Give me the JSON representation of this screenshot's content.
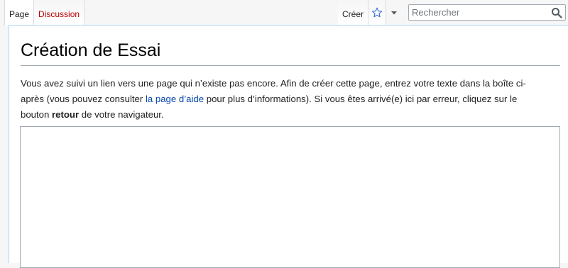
{
  "tabs": {
    "page": "Page",
    "discussion": "Discussion",
    "create": "Créer"
  },
  "search": {
    "placeholder": "Rechercher"
  },
  "icons": {
    "watch": "star-icon",
    "more": "chevron-down-icon",
    "search": "magnifier-icon"
  },
  "colors": {
    "link": "#0645ad",
    "redlink": "#ba0000",
    "border_blue": "#a7d7f9"
  },
  "page": {
    "title": "Création de Essai",
    "intro_part1": "Vous avez suivi un lien vers une page qui n’existe pas encore. Afin de créer cette page, entrez votre texte dans la boîte ci-après (vous pouvez consulter ",
    "help_link": "la page d’aide",
    "intro_part2": " pour plus d’informations). Si vous êtes arrivé(e) ici par erreur, cliquez sur le bouton ",
    "back_word": "retour",
    "intro_part3": " de votre navigateur."
  },
  "editor": {
    "value": ""
  }
}
